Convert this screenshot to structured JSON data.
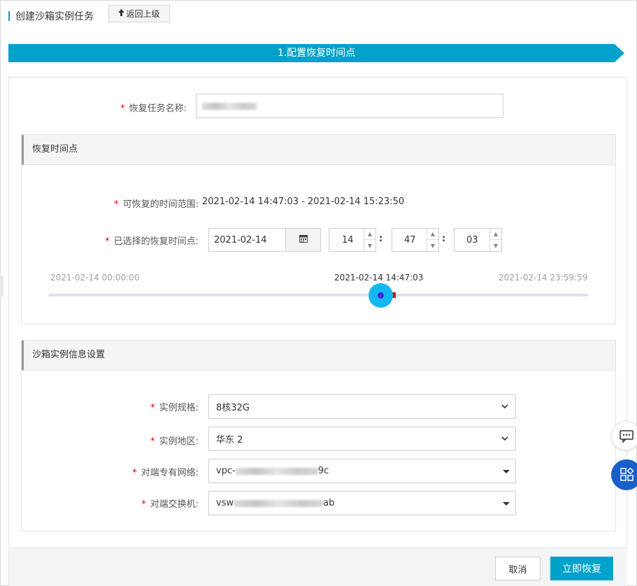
{
  "header": {
    "title": "创建沙箱实例任务",
    "back_label": "返回上级"
  },
  "step": {
    "label": "1.配置恢复时间点"
  },
  "task_name": {
    "label": "恢复任务名称:"
  },
  "restore_point": {
    "section_title": "恢复时间点",
    "range_label": "可恢复的时间范围:",
    "range_value": "2021-02-14 14:47:03 - 2021-02-14 15:23:50",
    "selected_label": "已选择的恢复时间点:",
    "date": "2021-02-14",
    "hour": "14",
    "minute": "47",
    "second": "03",
    "separator": ":",
    "slider": {
      "start_label": "2021-02-14 00:00:00",
      "current_label": "2021-02-14 14:47:03",
      "end_label": "2021-02-14 23:59:59",
      "position_fraction": 0.616
    }
  },
  "instance_settings": {
    "section_title": "沙箱实例信息设置",
    "spec_label": "实例规格:",
    "spec_value": "8核32G",
    "region_label": "实例地区:",
    "region_value": "华东 2",
    "vpc_label": "对端专有网络:",
    "vpc_prefix": "vpc-",
    "vpc_suffix": "9c",
    "vswitch_label": "对端交换机:",
    "vswitch_prefix": "vsw",
    "vswitch_suffix": "ab"
  },
  "footer": {
    "cancel_label": "取消",
    "confirm_label": "立即恢复"
  },
  "colors": {
    "accent": "#00a2ca",
    "required": "#ee0000",
    "slider_handle": "#14b8f0",
    "float_button": "#1a5fc9"
  },
  "icons": {
    "back": "upload-arrow-icon",
    "calendar": "calendar-icon",
    "chat": "chat-icon",
    "apps": "apps-icon"
  }
}
